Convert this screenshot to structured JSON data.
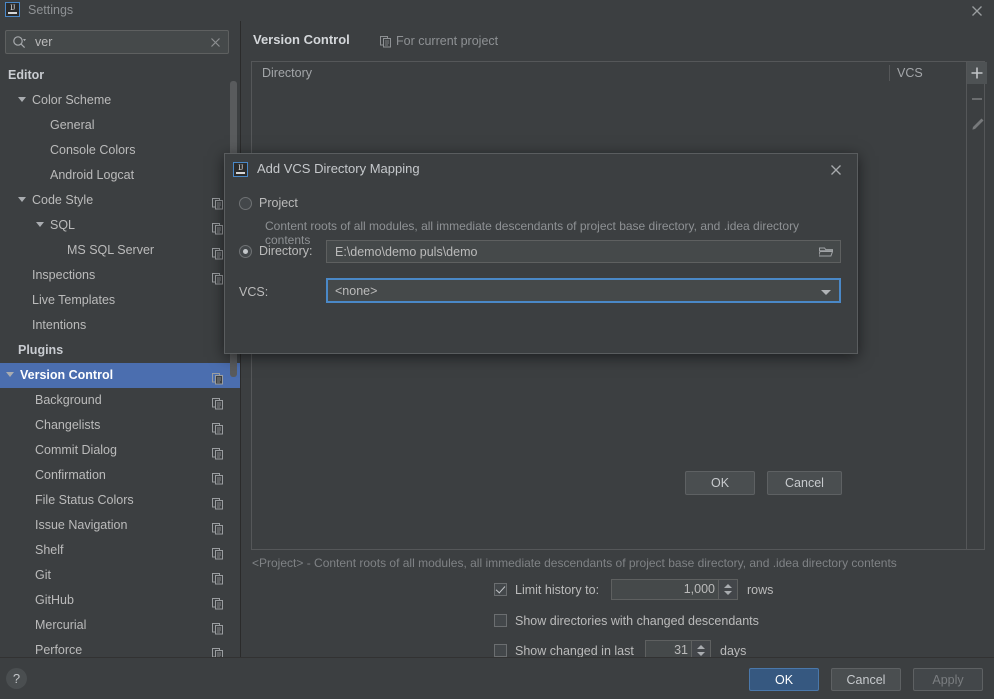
{
  "window": {
    "title": "Settings",
    "app_icon": "intellij-logo-icon",
    "close_icon": "close-icon"
  },
  "search": {
    "value": "ver",
    "placeholder": "",
    "icon": "search-icon",
    "clear_icon": "clear-icon"
  },
  "sidebar": {
    "items": [
      {
        "label": "Editor",
        "indent": 8,
        "bold": true,
        "arrow": false,
        "selected": false,
        "copy_icon": false
      },
      {
        "label": "Color Scheme",
        "indent": 32,
        "bold": false,
        "arrow": true,
        "selected": false,
        "copy_icon": false
      },
      {
        "label": "General",
        "indent": 50,
        "bold": false,
        "arrow": false,
        "selected": false,
        "copy_icon": false
      },
      {
        "label": "Console Colors",
        "indent": 50,
        "bold": false,
        "arrow": false,
        "selected": false,
        "copy_icon": false
      },
      {
        "label": "Android Logcat",
        "indent": 50,
        "bold": false,
        "arrow": false,
        "selected": false,
        "copy_icon": false
      },
      {
        "label": "Code Style",
        "indent": 32,
        "bold": false,
        "arrow": true,
        "selected": false,
        "copy_icon": true
      },
      {
        "label": "SQL",
        "indent": 50,
        "bold": false,
        "arrow": true,
        "selected": false,
        "copy_icon": true
      },
      {
        "label": "MS SQL Server",
        "indent": 67,
        "bold": false,
        "arrow": false,
        "selected": false,
        "copy_icon": true
      },
      {
        "label": "Inspections",
        "indent": 32,
        "bold": false,
        "arrow": false,
        "selected": false,
        "copy_icon": true
      },
      {
        "label": "Live Templates",
        "indent": 32,
        "bold": false,
        "arrow": false,
        "selected": false,
        "copy_icon": false
      },
      {
        "label": "Intentions",
        "indent": 32,
        "bold": false,
        "arrow": false,
        "selected": false,
        "copy_icon": false
      },
      {
        "label": "Plugins",
        "indent": 18,
        "bold": true,
        "arrow": false,
        "selected": false,
        "copy_icon": false
      },
      {
        "label": "Version Control",
        "indent": 20,
        "bold": true,
        "arrow": true,
        "selected": true,
        "copy_icon": true
      },
      {
        "label": "Background",
        "indent": 35,
        "bold": false,
        "arrow": false,
        "selected": false,
        "copy_icon": true
      },
      {
        "label": "Changelists",
        "indent": 35,
        "bold": false,
        "arrow": false,
        "selected": false,
        "copy_icon": true
      },
      {
        "label": "Commit Dialog",
        "indent": 35,
        "bold": false,
        "arrow": false,
        "selected": false,
        "copy_icon": true
      },
      {
        "label": "Confirmation",
        "indent": 35,
        "bold": false,
        "arrow": false,
        "selected": false,
        "copy_icon": true
      },
      {
        "label": "File Status Colors",
        "indent": 35,
        "bold": false,
        "arrow": false,
        "selected": false,
        "copy_icon": true
      },
      {
        "label": "Issue Navigation",
        "indent": 35,
        "bold": false,
        "arrow": false,
        "selected": false,
        "copy_icon": true
      },
      {
        "label": "Shelf",
        "indent": 35,
        "bold": false,
        "arrow": false,
        "selected": false,
        "copy_icon": true
      },
      {
        "label": "Git",
        "indent": 35,
        "bold": false,
        "arrow": false,
        "selected": false,
        "copy_icon": true
      },
      {
        "label": "GitHub",
        "indent": 35,
        "bold": false,
        "arrow": false,
        "selected": false,
        "copy_icon": true
      },
      {
        "label": "Mercurial",
        "indent": 35,
        "bold": false,
        "arrow": false,
        "selected": false,
        "copy_icon": true
      },
      {
        "label": "Perforce",
        "indent": 35,
        "bold": false,
        "arrow": false,
        "selected": false,
        "copy_icon": true
      }
    ]
  },
  "main": {
    "title": "Version Control",
    "scope_note": "For current project",
    "scope_icon": "copy-scope-icon",
    "table": {
      "columns": [
        "Directory",
        "VCS"
      ],
      "rows": []
    },
    "toolbar": [
      {
        "name": "add-mapping-button",
        "icon": "plus-icon",
        "active": true
      },
      {
        "name": "remove-mapping-button",
        "icon": "minus-icon",
        "active": false
      },
      {
        "name": "edit-mapping-button",
        "icon": "pencil-icon",
        "active": false
      }
    ],
    "legend": "<Project> - Content roots of all modules, all immediate descendants of project base directory, and .idea directory contents",
    "options": {
      "limit_history_label": "Limit history to:",
      "limit_history_checked": true,
      "limit_history_value": "1,000",
      "limit_history_suffix": "rows",
      "show_dirs_label": "Show directories with changed descendants",
      "show_dirs_checked": false,
      "show_changed_label": "Show changed in last",
      "show_changed_checked": false,
      "show_changed_value": "31",
      "show_changed_suffix": "days"
    }
  },
  "footer": {
    "help_label": "?",
    "ok_label": "OK",
    "cancel_label": "Cancel",
    "apply_label": "Apply"
  },
  "dialog": {
    "title": "Add VCS Directory Mapping",
    "icon": "intellij-logo-icon",
    "close_icon": "close-icon",
    "project_radio_label": "Project",
    "project_radio_selected": false,
    "project_description": "Content roots of all modules, all immediate descendants of project base directory, and .idea directory contents",
    "directory_radio_label": "Directory:",
    "directory_radio_selected": true,
    "directory_value": "E:\\demo\\demo puls\\demo",
    "browse_icon": "folder-icon",
    "vcs_label": "VCS:",
    "vcs_value": "<none>",
    "vcs_dropdown_icon": "chevron-down-icon",
    "ok_label": "OK",
    "cancel_label": "Cancel"
  },
  "colors": {
    "background": "#3c3f41",
    "selection": "#4b6eaf",
    "primary_button": "#365880",
    "focus_border": "#4a88c7",
    "text": "#bbbbbb",
    "muted_text": "#8e9194"
  }
}
